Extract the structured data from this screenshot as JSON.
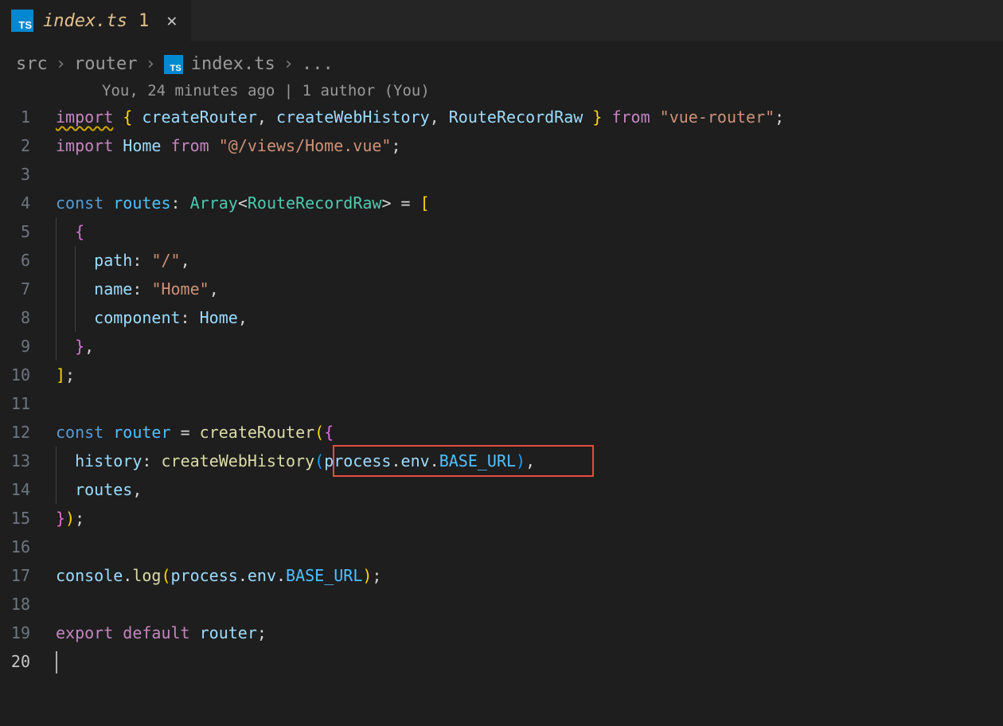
{
  "tab": {
    "icon_text": "TS",
    "filename": "index.ts",
    "modified_indicator": "1",
    "close_glyph": "✕"
  },
  "breadcrumb": {
    "parts": [
      "src",
      "router",
      "index.ts",
      "..."
    ],
    "icon_text": "TS",
    "sep": "›"
  },
  "codelens": "You, 24 minutes ago | 1 author (You)",
  "lines": {
    "l1": {
      "import": "import",
      "lb": "{",
      "a1": "createRouter",
      "c1": ",",
      "a2": "createWebHistory",
      "c2": ",",
      "a3": "RouteRecordRaw",
      "rb": "}",
      "from": "from",
      "str": "\"vue-router\"",
      "semi": ";"
    },
    "l2": {
      "import": "import",
      "name": "Home",
      "from": "from",
      "str": "\"@/views/Home.vue\"",
      "semi": ";"
    },
    "l4": {
      "const": "const",
      "name": "routes",
      "colon": ":",
      "arr": "Array",
      "lt": "<",
      "type": "RouteRecordRaw",
      "gt": ">",
      "eq": "=",
      "lb": "["
    },
    "l5": {
      "lb": "{"
    },
    "l6": {
      "key": "path",
      "colon": ":",
      "val": "\"/\"",
      "comma": ","
    },
    "l7": {
      "key": "name",
      "colon": ":",
      "val": "\"Home\"",
      "comma": ","
    },
    "l8": {
      "key": "component",
      "colon": ":",
      "val": "Home",
      "comma": ","
    },
    "l9": {
      "rb": "}",
      "comma": ","
    },
    "l10": {
      "rb": "]",
      "semi": ";"
    },
    "l12": {
      "const": "const",
      "name": "router",
      "eq": "=",
      "fn": "createRouter",
      "lp": "(",
      "lb": "{"
    },
    "l13": {
      "key": "history",
      "colon": ":",
      "fn": "createWebHistory",
      "lp": "(",
      "proc": "process",
      "dot1": ".",
      "env": "env",
      "dot2": ".",
      "base": "BASE_URL",
      "rp": ")",
      "comma": ","
    },
    "l14": {
      "key": "routes",
      "comma": ","
    },
    "l15": {
      "rb": "}",
      "rp": ")",
      "semi": ";"
    },
    "l17": {
      "obj": "console",
      "dot": ".",
      "fn": "log",
      "lp": "(",
      "proc": "process",
      "dot1": ".",
      "env": "env",
      "dot2": ".",
      "base": "BASE_URL",
      "rp": ")",
      "semi": ";"
    },
    "l19": {
      "export": "export",
      "default": "default",
      "name": "router",
      "semi": ";"
    }
  },
  "line_numbers": [
    "1",
    "2",
    "3",
    "4",
    "5",
    "6",
    "7",
    "8",
    "9",
    "10",
    "11",
    "12",
    "13",
    "14",
    "15",
    "16",
    "17",
    "18",
    "19",
    "20"
  ]
}
